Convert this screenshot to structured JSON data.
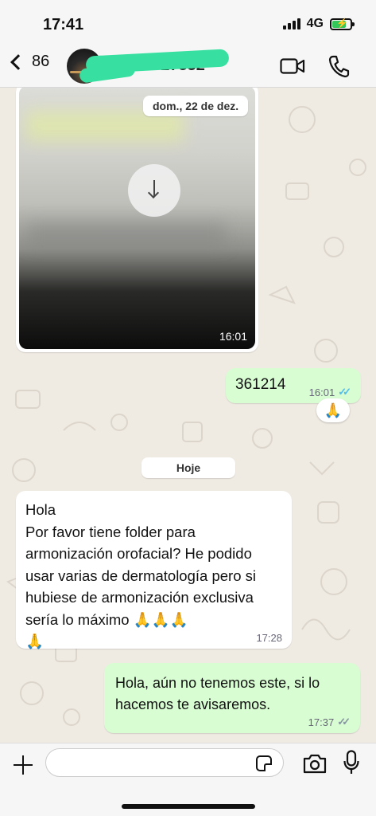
{
  "status_bar": {
    "time": "17:41",
    "network": "4G",
    "battery_level": 0.75,
    "battery_charging": true
  },
  "header": {
    "unread_count": "86",
    "contact_name": "··· ··· 327332",
    "contact_name_redacted": true,
    "video_icon": "video-camera-icon",
    "call_icon": "phone-icon"
  },
  "messages": [
    {
      "type": "image",
      "direction": "incoming",
      "overlay_date": "dom., 22 de dez.",
      "time": "16:01",
      "download_icon": "download-arrow-icon"
    },
    {
      "type": "text",
      "direction": "outgoing",
      "text": "361214",
      "time": "16:01",
      "status": "read",
      "reaction": "🙏"
    },
    {
      "type": "date_separator",
      "text": "Hoje"
    },
    {
      "type": "text",
      "direction": "incoming",
      "text": "Hola\nPor favor tiene folder para armonización orofacial? He podido usar varias de dermatología pero si hubiese de  armonización exclusiva sería lo máximo 🙏🙏🙏\n🙏",
      "time": "17:28"
    },
    {
      "type": "text",
      "direction": "outgoing",
      "text": "Hola, aún no tenemos este, si lo\nhacemos te avisaremos.",
      "time": "17:37",
      "status": "delivered"
    }
  ],
  "input": {
    "value": "",
    "placeholder": "",
    "plus_icon": "plus-icon",
    "sticker_icon": "sticker-icon",
    "camera_icon": "camera-icon",
    "mic_icon": "microphone-icon"
  },
  "colors": {
    "chat_background": "#efeae2",
    "incoming_bubble": "#ffffff",
    "outgoing_bubble": "#d9fdd3",
    "read_ticks": "#53bdeb",
    "delivered_ticks": "#8696a0",
    "header_background": "#f6f6f6"
  }
}
